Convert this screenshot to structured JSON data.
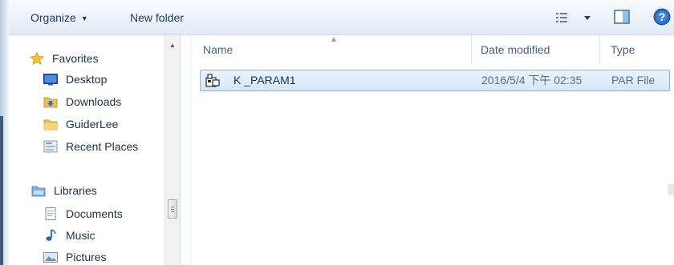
{
  "toolbar": {
    "organize_label": "Organize",
    "new_folder_label": "New folder"
  },
  "nav": {
    "favorites": {
      "header": "Favorites",
      "items": [
        {
          "label": "Desktop",
          "icon": "desktop-icon"
        },
        {
          "label": "Downloads",
          "icon": "downloads-folder-icon"
        },
        {
          "label": "GuiderLee",
          "icon": "user-folder-icon"
        },
        {
          "label": "Recent Places",
          "icon": "recent-places-icon"
        }
      ]
    },
    "libraries": {
      "header": "Libraries",
      "items": [
        {
          "label": "Documents",
          "icon": "documents-icon"
        },
        {
          "label": "Music",
          "icon": "music-icon"
        },
        {
          "label": "Pictures",
          "icon": "pictures-icon"
        }
      ]
    }
  },
  "list": {
    "columns": [
      "Name",
      "Date modified",
      "Type"
    ],
    "rows": [
      {
        "name": "K _PARAM1",
        "date_modified": "2016/5/4 下午 02:35",
        "type": "PAR File",
        "icon": "par-file-icon",
        "selected": true
      }
    ]
  },
  "colors": {
    "toolbar_bg": "#eef4fb",
    "selection_bg": "#d5e7fb",
    "selection_border": "#88b2e2",
    "text": "#1e3048",
    "favorites_star": "#f2c233"
  }
}
